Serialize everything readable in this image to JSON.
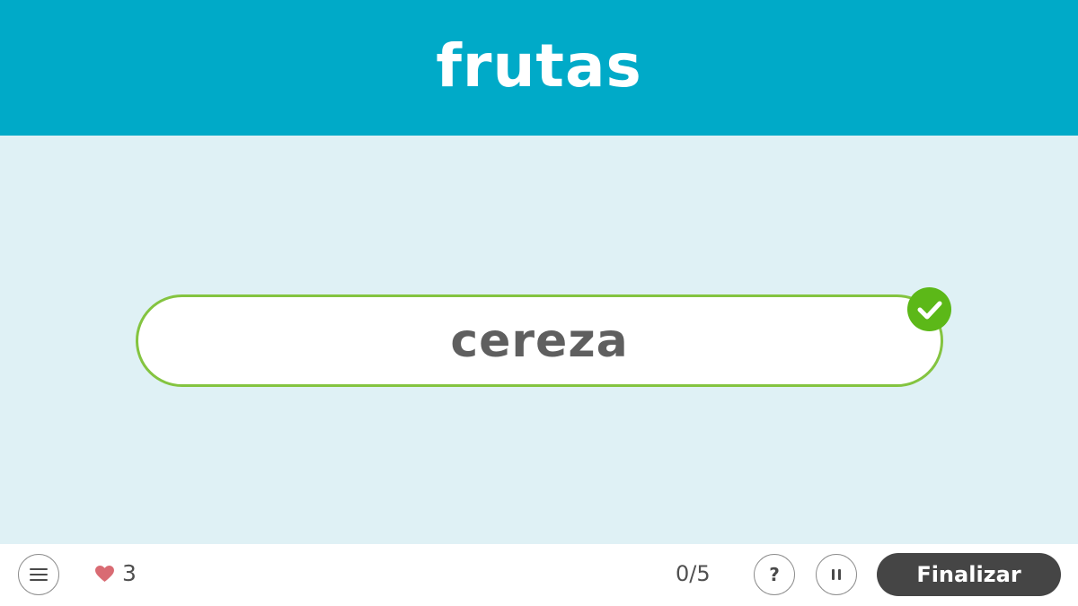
{
  "header": {
    "title": "frutas"
  },
  "answer": {
    "word": "cereza",
    "status": "correct",
    "status_icon": "check-icon"
  },
  "footer": {
    "menu_icon": "hamburger-menu-icon",
    "lives_icon": "heart-icon",
    "lives": "3",
    "progress": "0/5",
    "help_label": "?",
    "pause_icon": "pause-icon",
    "finish_label": "Finalizar"
  },
  "colors": {
    "header_bg": "#00aac8",
    "content_bg": "#dff1f5",
    "pill_border": "#84c440",
    "check_bg": "#5cb818",
    "heart": "#d96b73",
    "finish_bg": "#454545"
  }
}
